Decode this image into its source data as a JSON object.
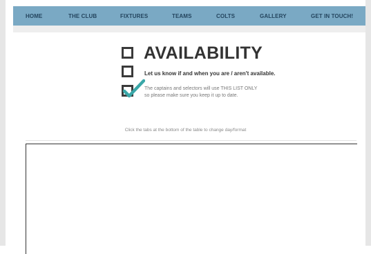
{
  "nav": {
    "items": [
      {
        "label": "HOME"
      },
      {
        "label": "THE CLUB"
      },
      {
        "label": "FIXTURES"
      },
      {
        "label": "TEAMS"
      },
      {
        "label": "COLTS"
      },
      {
        "label": "GALLERY"
      },
      {
        "label": "GET IN TOUCH!"
      }
    ]
  },
  "availability": {
    "title": "AVAILABILITY",
    "subtitle": "Let us know if and when you are / aren't available.",
    "note_line1": "The captains and selectors will use THIS LIST ONLY",
    "note_line2": "so please make sure you keep it up to date."
  },
  "hint": "Click the tabs at the bottom of the table to change day/format",
  "colors": {
    "nav_bg": "#7aa9c4",
    "nav_text": "#24455e",
    "check_mark": "#3aa7a8",
    "checkbox_border": "#3a3a3a"
  },
  "icons": [
    "checkbox-empty-icon",
    "checkbox-checked-icon"
  ]
}
